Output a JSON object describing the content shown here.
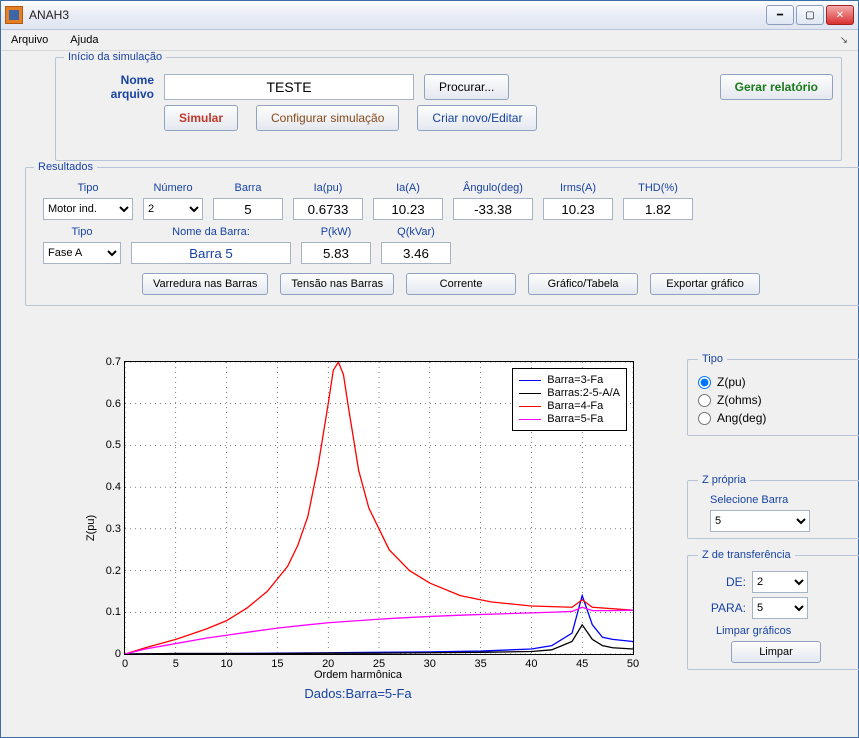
{
  "window": {
    "title": "ANAH3"
  },
  "menu": {
    "arquivo": "Arquivo",
    "ajuda": "Ajuda"
  },
  "fs_top": {
    "legend": "Início da simulação",
    "nome_arquivo_lbl_l1": "Nome",
    "nome_arquivo_lbl_l2": "arquivo",
    "nome_arquivo_val": "TESTE",
    "procurar": "Procurar...",
    "gerar": "Gerar relatório",
    "simular": "Simular",
    "config": "Configurar simulação",
    "novo": "Criar novo/Editar"
  },
  "results": {
    "legend": "Resultados",
    "row1": {
      "h": [
        "Tipo",
        "Número",
        "Barra",
        "Ia(pu)",
        "Ia(A)",
        "Ângulo(deg)",
        "Irms(A)",
        "THD(%)"
      ],
      "tipo": "Motor ind.",
      "numero": "2",
      "barra": "5",
      "iapu": "0.6733",
      "iaA": "10.23",
      "ang": "-33.38",
      "irms": "10.23",
      "thd": "1.82"
    },
    "row2": {
      "h": [
        "Tipo",
        "Nome da Barra:",
        "P(kW)",
        "Q(kVar)"
      ],
      "tipo": "Fase A",
      "nome": "Barra 5",
      "p": "5.83",
      "q": "3.46"
    },
    "btns": {
      "varredura": "Varredura nas Barras",
      "tensao": "Tensão nas Barras",
      "corrente": "Corrente",
      "grafico": "Gráfico/Tabela",
      "export": "Exportar gráfico"
    }
  },
  "right": {
    "tipo": {
      "legend": "Tipo",
      "opts": [
        "Z(pu)",
        "Z(ohms)",
        "Ang(deg)"
      ],
      "selected": 0
    },
    "zpropria": {
      "legend": "Z própria",
      "label": "Selecione Barra",
      "val": "5"
    },
    "ztrans": {
      "legend": "Z de transferência",
      "de_l": "DE:",
      "de": "2",
      "para_l": "PARA:",
      "para": "5",
      "limparg": "Limpar gráficos",
      "limpar": "Limpar"
    }
  },
  "chart_data": {
    "type": "line",
    "title": "",
    "xlabel": "Ordem harmônica",
    "ylabel": "Z(pu)",
    "subtitle": "Dados:Barra=5-Fa",
    "xlim": [
      0,
      50
    ],
    "ylim": [
      0,
      0.7
    ],
    "xticks": [
      0,
      5,
      10,
      15,
      20,
      25,
      30,
      35,
      40,
      45,
      50
    ],
    "yticks": [
      0,
      0.1,
      0.2,
      0.3,
      0.4,
      0.5,
      0.6,
      0.7
    ],
    "series": [
      {
        "name": "Barra=3-Fa",
        "color": "#0000ff",
        "x": [
          0,
          5,
          10,
          15,
          20,
          25,
          30,
          35,
          40,
          42,
          44,
          45,
          46,
          47,
          48,
          50
        ],
        "y": [
          0,
          0.001,
          0.001,
          0.002,
          0.003,
          0.004,
          0.005,
          0.007,
          0.012,
          0.02,
          0.05,
          0.14,
          0.07,
          0.04,
          0.035,
          0.03
        ]
      },
      {
        "name": "Barras:2-5-A/A",
        "color": "#000000",
        "x": [
          0,
          5,
          10,
          15,
          20,
          25,
          30,
          35,
          40,
          42,
          44,
          45,
          46,
          47,
          48,
          50
        ],
        "y": [
          0,
          0.001,
          0.001,
          0.001,
          0.002,
          0.002,
          0.003,
          0.004,
          0.006,
          0.01,
          0.03,
          0.07,
          0.035,
          0.02,
          0.015,
          0.012
        ]
      },
      {
        "name": "Barra=4-Fa",
        "color": "#ff0000",
        "x": [
          0,
          2,
          5,
          8,
          10,
          12,
          14,
          16,
          17,
          18,
          19,
          20,
          20.5,
          21,
          21.5,
          22,
          23,
          24,
          26,
          28,
          30,
          33,
          36,
          40,
          44,
          45,
          46,
          50
        ],
        "y": [
          0,
          0.015,
          0.035,
          0.06,
          0.08,
          0.11,
          0.15,
          0.21,
          0.26,
          0.33,
          0.45,
          0.6,
          0.68,
          0.7,
          0.67,
          0.59,
          0.44,
          0.35,
          0.25,
          0.2,
          0.17,
          0.14,
          0.125,
          0.115,
          0.112,
          0.13,
          0.112,
          0.105
        ]
      },
      {
        "name": "Barra=5-Fa",
        "color": "#ff00ff",
        "x": [
          0,
          2,
          5,
          8,
          10,
          12,
          15,
          18,
          20,
          23,
          26,
          30,
          34,
          38,
          42,
          44,
          45,
          46,
          48,
          50
        ],
        "y": [
          0,
          0.012,
          0.025,
          0.038,
          0.045,
          0.052,
          0.062,
          0.07,
          0.075,
          0.08,
          0.085,
          0.09,
          0.094,
          0.097,
          0.1,
          0.102,
          0.112,
          0.104,
          0.104,
          0.105
        ]
      }
    ]
  }
}
